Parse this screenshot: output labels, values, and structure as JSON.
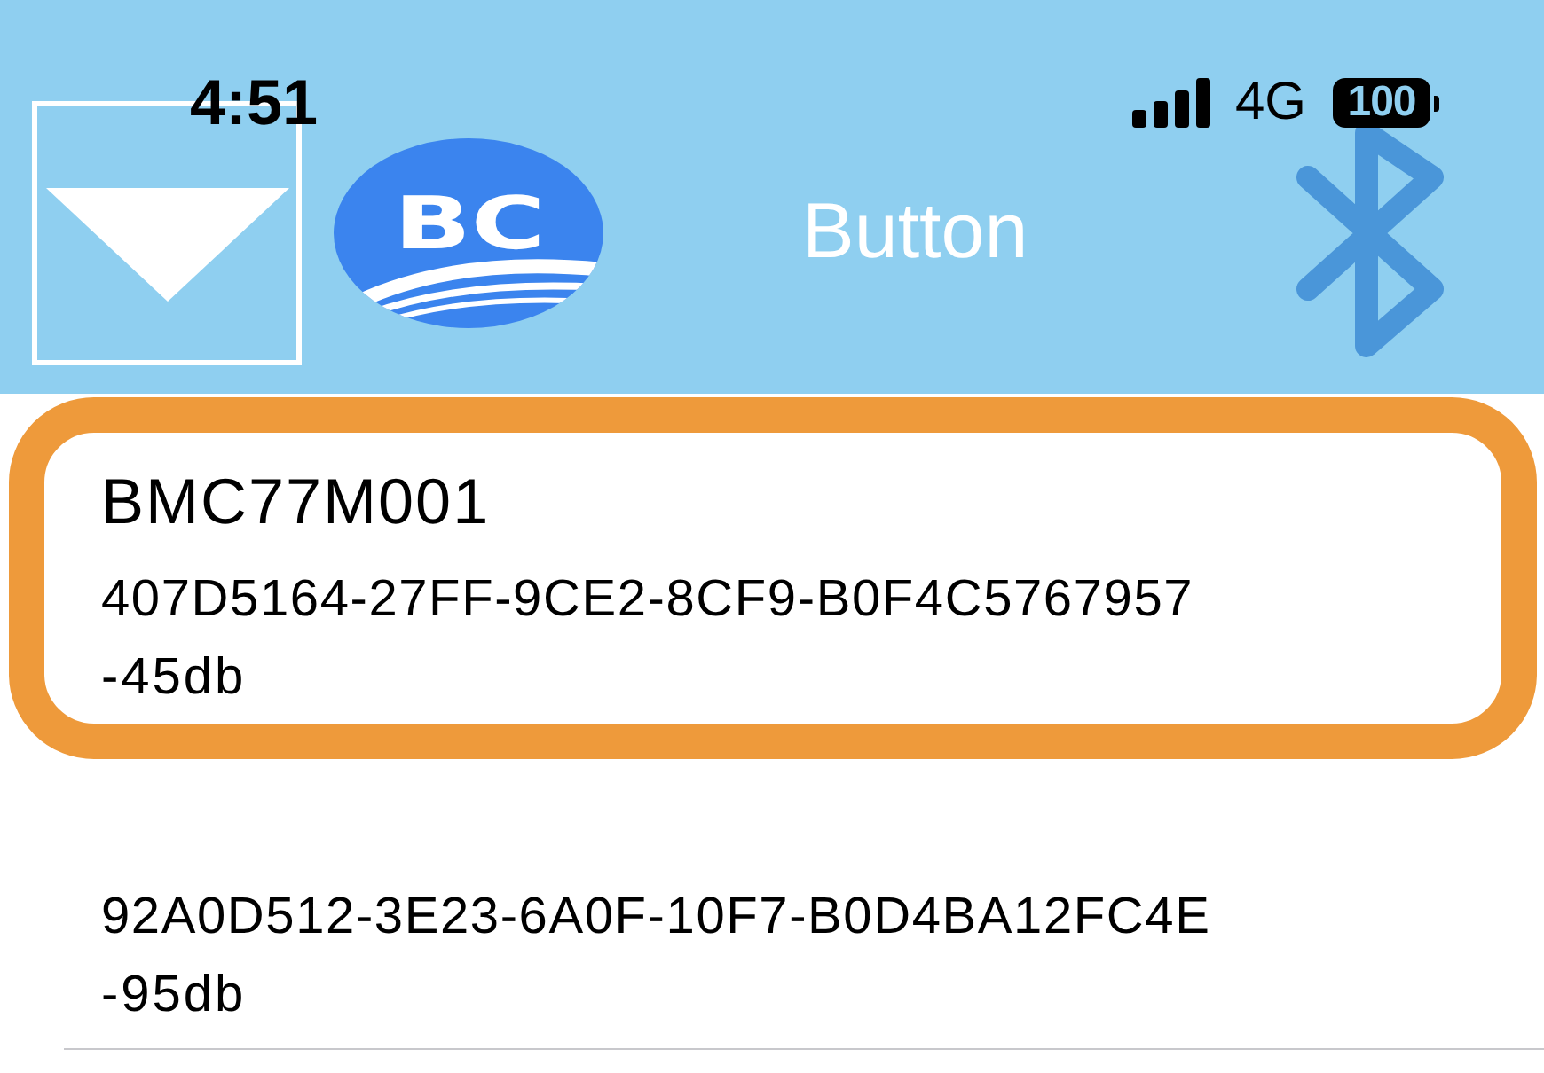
{
  "status_bar": {
    "time": "4:51",
    "network": "4G",
    "battery": "100"
  },
  "header": {
    "logo_text": "BC",
    "title": "Button"
  },
  "devices": [
    {
      "name": "BMC77M001",
      "uuid": "407D5164-27FF-9CE2-8CF9-B0F4C5767957",
      "rssi": "-45db",
      "highlighted": true
    },
    {
      "uuid": "92A0D512-3E23-6A0F-10F7-B0D4BA12FC4E",
      "rssi": "-95db",
      "highlighted": false
    }
  ]
}
